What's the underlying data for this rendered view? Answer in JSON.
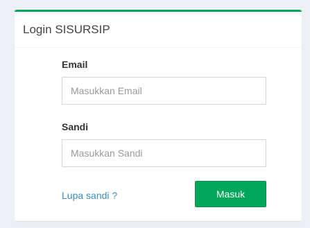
{
  "login": {
    "title": "Login SISURSIP",
    "email": {
      "label": "Email",
      "placeholder": "Masukkan Email",
      "value": ""
    },
    "password": {
      "label": "Sandi",
      "placeholder": "Masukkan Sandi",
      "value": ""
    },
    "forgot_link": "Lupa sandi ?",
    "submit_label": "Masuk"
  },
  "colors": {
    "accent": "#00a65a",
    "link": "#3c8dbc",
    "background": "#ecf0f5"
  }
}
